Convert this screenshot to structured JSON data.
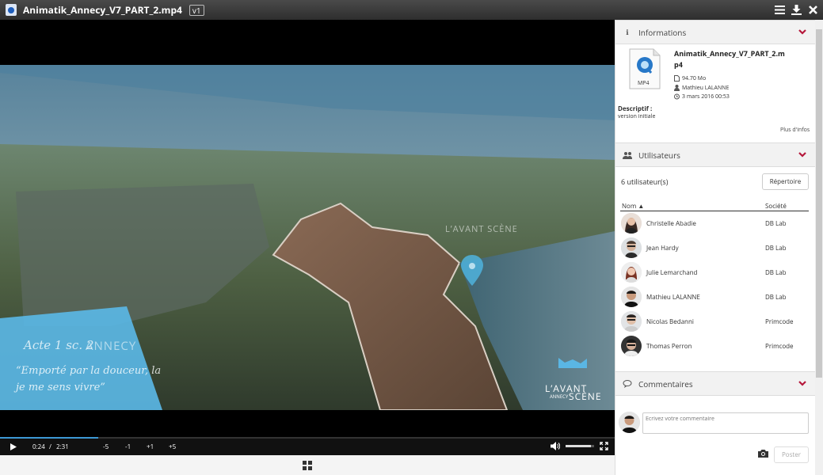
{
  "titlebar": {
    "file_name": "Animatik_Annecy_V7_PART_2.mp4",
    "version": "v1",
    "icons": [
      "menu-icon",
      "download-icon",
      "close-icon"
    ]
  },
  "video": {
    "overlay_title": "Acte 1 sc. 2",
    "overlay_place": "ANNECY",
    "overlay_quote_1": "“Emporté par la douceur, la",
    "overlay_quote_2": "je me sens vivre”",
    "logo_line1": "L’AVANT",
    "logo_line2": "SCÈNE",
    "logo_small": "ANNECY",
    "map_label": "L’AVANT SCÈNE"
  },
  "controls": {
    "current_time": "0:24",
    "separator": "/",
    "duration": "2:31",
    "progress_fraction": 0.16,
    "volume_fraction": 0.9,
    "skip_back_5": "-5",
    "skip_back_1": "-1",
    "skip_fwd_1": "+1",
    "skip_fwd_5": "+5"
  },
  "info": {
    "header": "Informations",
    "file_label": "MP4",
    "file_name_line1": "Animatik_Annecy_V7_PART_2.m",
    "file_name_line2": "p4",
    "size": "94.70 Mo",
    "author": "Mathieu LALANNE",
    "date": "3 mars 2016 00:53",
    "description_label": "Descriptif :",
    "description": "version initiale",
    "more_link": "Plus d'infos"
  },
  "users": {
    "header": "Utilisateurs",
    "count": "6 utilisateur(s)",
    "directory_button": "Répertoire",
    "col_name": "Nom ▲",
    "col_company": "Société",
    "rows": [
      {
        "name": "Christelle Abadie",
        "company": "DB Lab"
      },
      {
        "name": "Jean Hardy",
        "company": "DB Lab"
      },
      {
        "name": "Julie Lemarchand",
        "company": "DB Lab"
      },
      {
        "name": "Mathieu LALANNE",
        "company": "DB Lab"
      },
      {
        "name": "Nicolas Bedanni",
        "company": "Primcode"
      },
      {
        "name": "Thomas Perron",
        "company": "Primcode"
      }
    ]
  },
  "comments": {
    "header": "Commentaires",
    "placeholder": "Ecrivez votre commentaire",
    "post_button": "Poster"
  },
  "colors": {
    "accent_red": "#b5173a",
    "progress_blue": "#3d98d4",
    "overlay_blue": "#5ab6e4"
  }
}
